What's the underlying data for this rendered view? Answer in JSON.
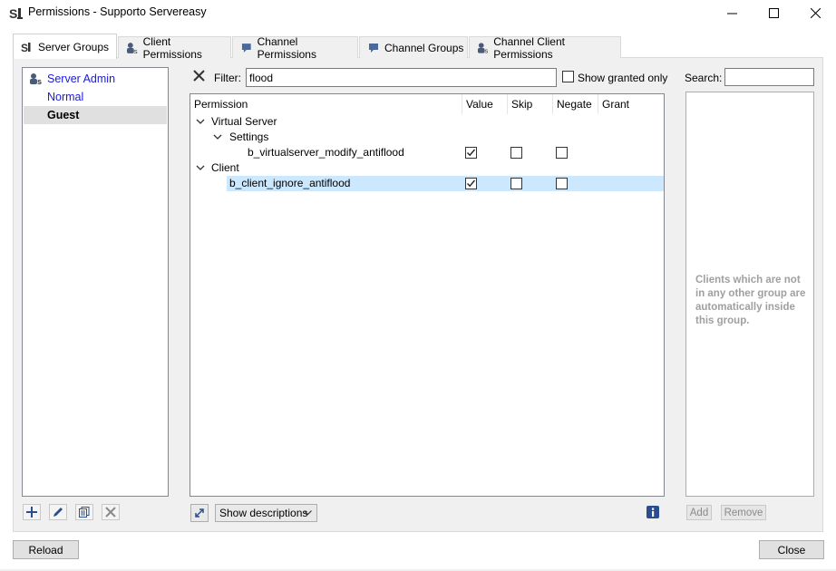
{
  "window": {
    "title": "Permissions - Supporto Servereasy",
    "minimize": "—",
    "maximize": "☐",
    "close": "✕"
  },
  "tabs": [
    {
      "label": "Server Groups",
      "icon": "server-group-icon",
      "active": true
    },
    {
      "label": "Client Permissions",
      "icon": "client-icon",
      "active": false
    },
    {
      "label": "Channel Permissions",
      "icon": "channel-icon",
      "active": false
    },
    {
      "label": "Channel Groups",
      "icon": "channel-icon",
      "active": false
    },
    {
      "label": "Channel Client Permissions",
      "icon": "client-icon",
      "active": false
    }
  ],
  "groups": {
    "items": [
      {
        "label": "Server Admin",
        "color": "#1a1adb",
        "icon": "admin-icon"
      },
      {
        "label": "Normal",
        "color": "#1a1adb"
      },
      {
        "label": "Guest",
        "color": "#000000",
        "selected": true
      }
    ],
    "toolbar": [
      "add-icon",
      "edit-icon",
      "copy-icon",
      "delete-icon"
    ]
  },
  "filter": {
    "label": "Filter:",
    "value": "flood",
    "show_granted_label": "Show granted only",
    "show_granted_checked": false
  },
  "permissions": {
    "columns": [
      "Permission",
      "Value",
      "Skip",
      "Negate",
      "Grant"
    ],
    "rows": [
      {
        "label": "Virtual Server",
        "level": 0,
        "expanded": true,
        "kind": "group"
      },
      {
        "label": "Settings",
        "level": 1,
        "expanded": true,
        "kind": "group"
      },
      {
        "label": "b_virtualserver_modify_antiflood",
        "level": 2,
        "kind": "perm",
        "value": true,
        "skip": false,
        "negate": false
      },
      {
        "label": "Client",
        "level": 0,
        "expanded": true,
        "kind": "group"
      },
      {
        "label": "b_client_ignore_antiflood",
        "level": 1,
        "kind": "perm",
        "value": true,
        "skip": false,
        "negate": false,
        "selected": true
      }
    ]
  },
  "bottom_controls": {
    "descriptions_select": "Show descriptions"
  },
  "clients": {
    "search_label": "Search:",
    "search_value": "",
    "empty_note": "Clients which are not in any other group are automatically inside this group.",
    "add_label": "Add",
    "remove_label": "Remove"
  },
  "footer": {
    "reload_label": "Reload",
    "close_label": "Close"
  },
  "colors": {
    "selection": "#cce8ff",
    "group_link": "#1a1adb",
    "disabled_text": "#a0a0a0"
  }
}
